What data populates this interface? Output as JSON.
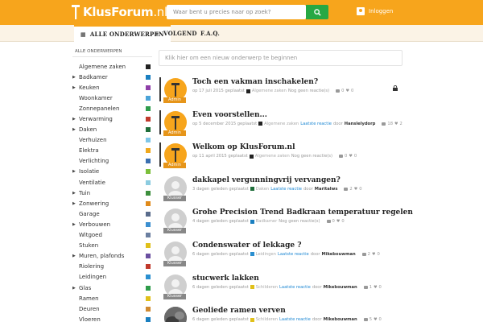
{
  "header": {
    "logo_main": "KlusForum",
    "logo_tld": ".nl",
    "search_placeholder": "Waar bent u precies naar op zoek?",
    "login_label": "Inloggen"
  },
  "nav": {
    "tabs": [
      {
        "label": "ALLE ONDERWERPEN",
        "icon": "document-icon"
      },
      {
        "label": "VOLGEND",
        "icon": "plus-icon"
      },
      {
        "label": "F.A.Q.",
        "icon": ""
      }
    ]
  },
  "sidebar": {
    "heading": "ALLE ONDERWERPEN",
    "categories": [
      {
        "label": "Algemene zaken",
        "color": "#222222",
        "arrow": false
      },
      {
        "label": "Badkamer",
        "color": "#1a7fc0",
        "arrow": true
      },
      {
        "label": "Keuken",
        "color": "#8e3fa8",
        "arrow": true
      },
      {
        "label": "Woonkamer",
        "color": "#4ba3d8",
        "arrow": false
      },
      {
        "label": "Zonnepanelen",
        "color": "#2e9c4a",
        "arrow": false
      },
      {
        "label": "Verwarming",
        "color": "#c0392b",
        "arrow": true
      },
      {
        "label": "Daken",
        "color": "#1f6e3a",
        "arrow": true
      },
      {
        "label": "Verhuizen",
        "color": "#7ec6e8",
        "arrow": false
      },
      {
        "label": "Elektra",
        "color": "#f0a81c",
        "arrow": false
      },
      {
        "label": "Verlichting",
        "color": "#3a6fb0",
        "arrow": false
      },
      {
        "label": "Isolatie",
        "color": "#7bbf3a",
        "arrow": true
      },
      {
        "label": "Ventilatie",
        "color": "#8ccce0",
        "arrow": false
      },
      {
        "label": "Tuin",
        "color": "#3d8f3d",
        "arrow": true
      },
      {
        "label": "Zonwering",
        "color": "#e08a1a",
        "arrow": true
      },
      {
        "label": "Garage",
        "color": "#5a6c8c",
        "arrow": false
      },
      {
        "label": "Verbouwen",
        "color": "#3c8fd0",
        "arrow": true
      },
      {
        "label": "Witgoed",
        "color": "#6b7fa0",
        "arrow": false
      },
      {
        "label": "Stuken",
        "color": "#e0c01a",
        "arrow": false
      },
      {
        "label": "Muren, plafonds",
        "color": "#6a4fa0",
        "arrow": true
      },
      {
        "label": "Riolering",
        "color": "#c0392b",
        "arrow": false
      },
      {
        "label": "Leidingen",
        "color": "#2a8fd0",
        "arrow": false
      },
      {
        "label": "Glas",
        "color": "#2e9c4a",
        "arrow": true
      },
      {
        "label": "Ramen",
        "color": "#e0c01a",
        "arrow": false
      },
      {
        "label": "Deuren",
        "color": "#d08a30",
        "arrow": false
      },
      {
        "label": "Vloeren",
        "color": "#1a7fc0",
        "arrow": false
      }
    ]
  },
  "main": {
    "new_topic_placeholder": "Klik hier om een nieuw onderwerp te beginnen",
    "topics": [
      {
        "title": "Toch een vakman inschakelen?",
        "avatar": "admin",
        "avatar_label": "Admin",
        "pinned": true,
        "locked": true,
        "date": "op 17 juli 2015 geplaatst",
        "category": "Algemene zaken",
        "cat_color": "#222222",
        "reply_text": "Nog geen reactie(s)",
        "reply_link": "",
        "by": "",
        "author": "",
        "replies": "0",
        "likes": "0"
      },
      {
        "title": "Even voorstellen...",
        "avatar": "admin",
        "avatar_label": "Admin",
        "pinned": true,
        "locked": false,
        "date": "op 5 december 2015 geplaatst",
        "category": "Algemene zaken",
        "cat_color": "#222222",
        "reply_text": "",
        "reply_link": "Laatste reactie",
        "by": "door",
        "author": "Hanslelydorp",
        "replies": "18",
        "likes": "2"
      },
      {
        "title": "Welkom op KlusForum.nl",
        "avatar": "admin",
        "avatar_label": "Admin",
        "pinned": true,
        "locked": false,
        "date": "op 11 april 2015 geplaatst",
        "category": "Algemene zaken",
        "cat_color": "#222222",
        "reply_text": "Nog geen reactie(s)",
        "reply_link": "",
        "by": "",
        "author": "",
        "replies": "0",
        "likes": "0"
      },
      {
        "title": "dakkapel vergunningvrij vervangen?",
        "avatar": "user",
        "avatar_label": "Klusser",
        "pinned": false,
        "locked": false,
        "date": "3 dagen geleden geplaatst",
        "category": "Daken",
        "cat_color": "#1f6e3a",
        "reply_text": "",
        "reply_link": "Laatste reactie",
        "by": "door",
        "author": "Maritalws",
        "replies": "2",
        "likes": "0"
      },
      {
        "title": "Grohe Precision Trend Badkraan temperatuur regelen",
        "avatar": "user",
        "avatar_label": "Klusser",
        "pinned": false,
        "locked": false,
        "date": "4 dagen geleden geplaatst",
        "category": "Badkamer",
        "cat_color": "#1a7fc0",
        "reply_text": "Nog geen reactie(s)",
        "reply_link": "",
        "by": "",
        "author": "",
        "replies": "0",
        "likes": "0"
      },
      {
        "title": "Condenswater of lekkage ?",
        "avatar": "user",
        "avatar_label": "Klusser",
        "pinned": false,
        "locked": false,
        "date": "6 dagen geleden geplaatst",
        "category": "Leidingen",
        "cat_color": "#2a8fd0",
        "reply_text": "",
        "reply_link": "Laatste reactie",
        "by": "door",
        "author": "Mikebouwman",
        "replies": "2",
        "likes": "0"
      },
      {
        "title": "stucwerk lakken",
        "avatar": "user",
        "avatar_label": "Klusser",
        "pinned": false,
        "locked": false,
        "date": "6 dagen geleden geplaatst",
        "category": "Schilderen",
        "cat_color": "#e0c01a",
        "reply_text": "",
        "reply_link": "Laatste reactie",
        "by": "door",
        "author": "Mikebouwman",
        "replies": "1",
        "likes": "0"
      },
      {
        "title": "Geoliede ramen verven",
        "avatar": "photo",
        "avatar_label": "",
        "pinned": false,
        "locked": false,
        "date": "6 dagen geleden geplaatst",
        "category": "Schilderen",
        "cat_color": "#e0c01a",
        "reply_text": "",
        "reply_link": "Laatste reactie",
        "by": "door",
        "author": "Mikebouwman",
        "replies": "5",
        "likes": "0"
      }
    ]
  },
  "colors": {
    "brand": "#f7a51c",
    "search_button": "#27a844",
    "link": "#1e88d3"
  }
}
